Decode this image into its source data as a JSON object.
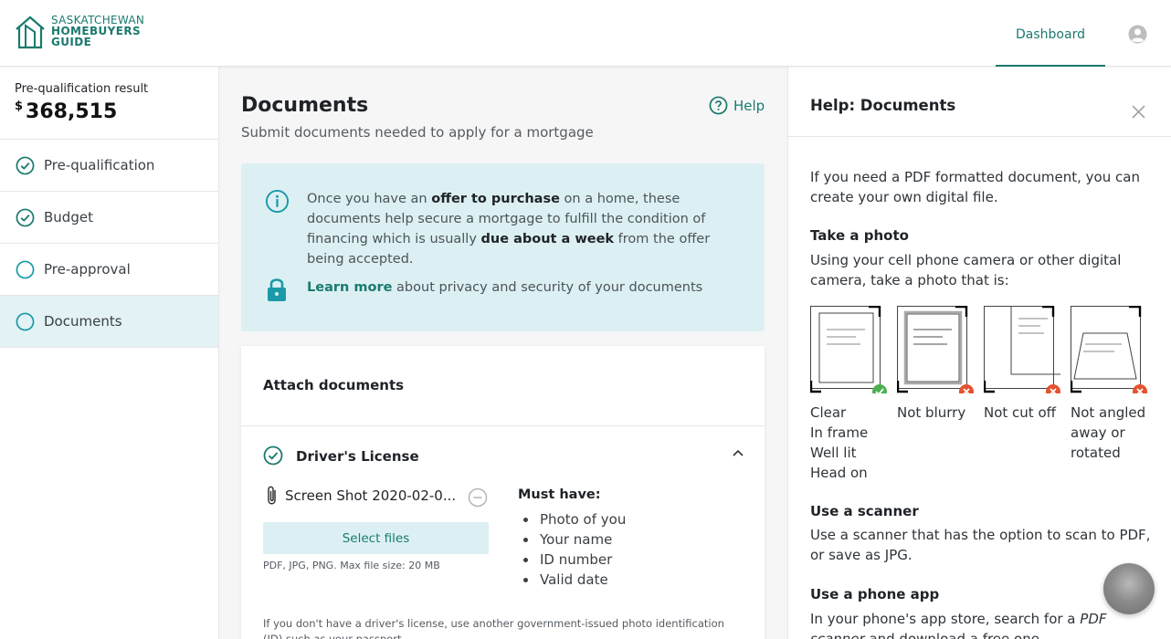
{
  "header": {
    "logo": {
      "line1": "SASKATCHEWAN",
      "line2": "HOMEBUYERS",
      "line3": "GUIDE"
    },
    "nav_dashboard": "Dashboard",
    "avatar_icon": "user-circle-icon"
  },
  "sidebar": {
    "prequal_label": "Pre-qualification result",
    "prequal_currency": "$",
    "prequal_amount": "368,515",
    "items": [
      {
        "label": "Pre-qualification",
        "status": "complete",
        "icon": "check-circle-icon"
      },
      {
        "label": "Budget",
        "status": "complete",
        "icon": "check-circle-icon"
      },
      {
        "label": "Pre-approval",
        "status": "incomplete",
        "icon": "empty-circle-icon"
      },
      {
        "label": "Documents",
        "status": "incomplete",
        "icon": "empty-circle-icon",
        "active": true
      }
    ]
  },
  "main": {
    "title": "Documents",
    "subtitle": "Submit documents needed to apply for a mortgage",
    "help_label": "Help",
    "info": {
      "t1": "Once you have an ",
      "b1": "offer to purchase",
      "t2": " on a home, these documents help secure a mortgage to fulfill the condition of financing which is usually ",
      "b2": "due about a week",
      "t3": " from the offer being accepted.",
      "learn_more": "Learn more",
      "privacy_rest": " about privacy and security of your documents"
    },
    "attach": {
      "title": "Attach documents",
      "doc_title": "Driver's License",
      "file_name": "Screen Shot 2020-02-0...",
      "select_files": "Select files",
      "file_hint": "PDF, JPG, PNG. Max file size: 20 MB",
      "must_have_title": "Must have:",
      "must_have": [
        "Photo of you",
        "Your name",
        "ID number",
        "Valid date"
      ],
      "footnote": "If you don't have a driver's license, use another government-issued photo identification (ID) such as your passport."
    }
  },
  "help_panel": {
    "title": "Help: Documents",
    "intro": "If you need a PDF formatted document, you can create your own digital file.",
    "photo_heading": "Take a photo",
    "photo_text": "Using your cell phone camera or other digital camera, take a photo that is:",
    "examples": [
      {
        "lines": [
          "Clear",
          "In frame",
          "Well lit",
          "Head on"
        ],
        "status": "good"
      },
      {
        "lines": [
          "Not blurry"
        ],
        "status": "bad"
      },
      {
        "lines": [
          "Not cut off"
        ],
        "status": "bad"
      },
      {
        "lines": [
          "Not angled",
          "away or",
          "rotated"
        ],
        "status": "bad"
      }
    ],
    "scanner_heading": "Use a scanner",
    "scanner_text": "Use a scanner that has the option to scan to PDF, or save as JPG.",
    "app_heading": "Use a phone app",
    "app_text_1": "In your phone's app store, search for a ",
    "app_text_em": "PDF scanner",
    "app_text_2": " and download a free one."
  },
  "colors": {
    "brand": "#1a7a6e",
    "info_bg": "#dcf0f3",
    "good": "#4caf50",
    "bad": "#e4522f"
  }
}
